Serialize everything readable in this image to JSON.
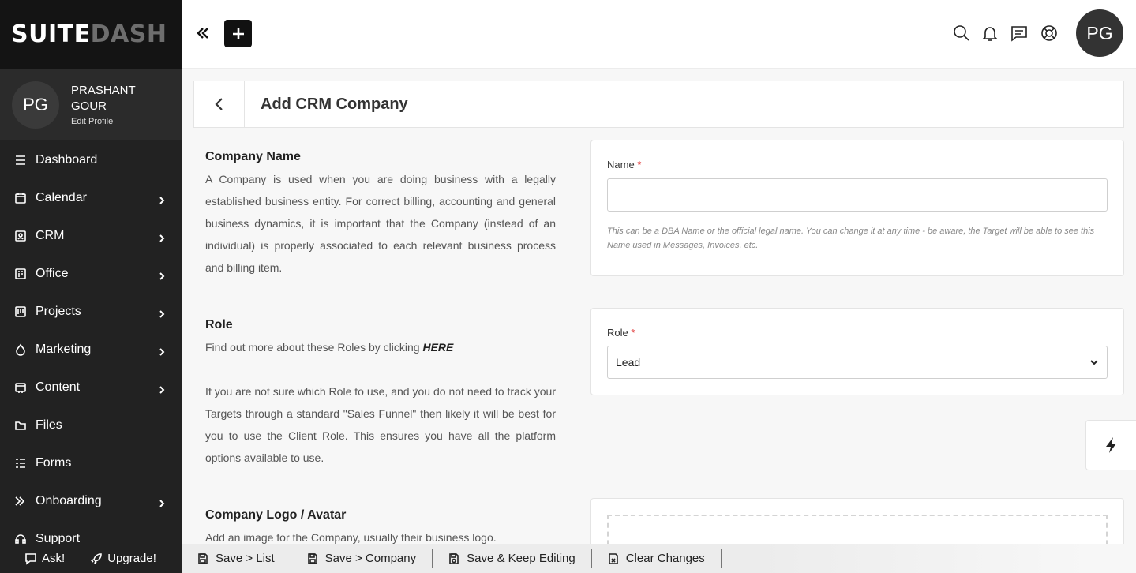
{
  "brand": {
    "part1": "SUITE",
    "part2": "DASH"
  },
  "profile": {
    "initials": "PG",
    "name": "PRASHANT GOUR",
    "edit_label": "Edit Profile"
  },
  "nav": [
    {
      "label": "Dashboard",
      "icon": "menu-lines-icon",
      "has_arrow": false
    },
    {
      "label": "Calendar",
      "icon": "calendar-icon",
      "has_arrow": true
    },
    {
      "label": "CRM",
      "icon": "id-card-icon",
      "has_arrow": true
    },
    {
      "label": "Office",
      "icon": "office-icon",
      "has_arrow": true
    },
    {
      "label": "Projects",
      "icon": "projects-icon",
      "has_arrow": true
    },
    {
      "label": "Marketing",
      "icon": "marketing-icon",
      "has_arrow": true
    },
    {
      "label": "Content",
      "icon": "content-icon",
      "has_arrow": true
    },
    {
      "label": "Files",
      "icon": "folder-icon",
      "has_arrow": false
    },
    {
      "label": "Forms",
      "icon": "forms-icon",
      "has_arrow": false
    },
    {
      "label": "Onboarding",
      "icon": "onboarding-icon",
      "has_arrow": true
    },
    {
      "label": "Support",
      "icon": "support-icon",
      "has_arrow": false
    }
  ],
  "topbar": {
    "user_initials": "PG"
  },
  "page": {
    "title": "Add CRM Company"
  },
  "company_name": {
    "title": "Company Name",
    "text": "A Company is used when you are doing business with a legally established business entity. For correct billing, accounting and general business dynamics, it is important that the Company (instead of an individual) is properly associated to each relevant business process and billing item.",
    "field_label": "Name",
    "required_mark": "*",
    "value": "",
    "help": "This can be a DBA Name or the official legal name. You can change it at any time - be aware, the Target will be able to see this Name used in Messages, Invoices, etc."
  },
  "role": {
    "title": "Role",
    "text1_prefix": "Find out more about these Roles by clicking ",
    "text1_link": "HERE",
    "text2": "If you are not sure which Role to use, and you do not need to track your Targets through a standard \"Sales Funnel\" then likely it will be best for you to use the Client Role. This ensures you have all the platform options available to use.",
    "field_label": "Role",
    "required_mark": "*",
    "selected": "Lead"
  },
  "logo": {
    "title": "Company Logo / Avatar",
    "text": "Add an image for the Company, usually their business logo."
  },
  "bottom": {
    "ask_label": "Ask!",
    "upgrade_label": "Upgrade!",
    "actions": [
      "Save > List",
      "Save > Company",
      "Save & Keep Editing",
      "Clear Changes"
    ]
  }
}
